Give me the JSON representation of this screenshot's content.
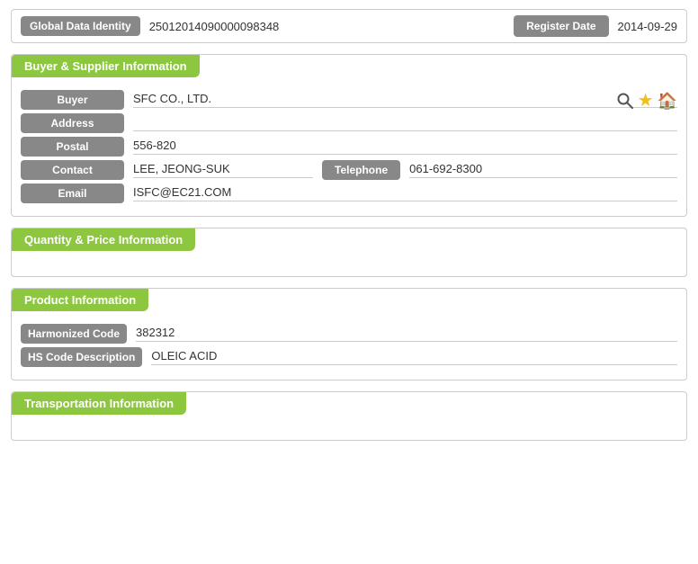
{
  "globalBar": {
    "label": "Global Data Identity",
    "value": "25012014090000098348",
    "registerDateLabel": "Register Date",
    "registerDateValue": "2014-09-29"
  },
  "buyerSupplier": {
    "sectionTitle": "Buyer & Supplier Information",
    "fields": {
      "buyerLabel": "Buyer",
      "buyerValue": "SFC CO., LTD.",
      "addressLabel": "Address",
      "addressValue": "",
      "postalLabel": "Postal",
      "postalValue": "556-820",
      "contactLabel": "Contact",
      "contactValue": "LEE, JEONG-SUK",
      "telephoneLabel": "Telephone",
      "telephoneValue": "061-692-8300",
      "emailLabel": "Email",
      "emailValue": "ISFC@EC21.COM"
    }
  },
  "quantityPrice": {
    "sectionTitle": "Quantity & Price Information"
  },
  "productInfo": {
    "sectionTitle": "Product Information",
    "fields": {
      "harmonizedCodeLabel": "Harmonized Code",
      "harmonizedCodeValue": "382312",
      "hsCodeDescLabel": "HS Code Description",
      "hsCodeDescValue": "OLEIC ACID"
    }
  },
  "transportation": {
    "sectionTitle": "Transportation Information"
  },
  "icons": {
    "searchIcon": "🔍",
    "starIcon": "★",
    "homeIcon": "🏠"
  }
}
